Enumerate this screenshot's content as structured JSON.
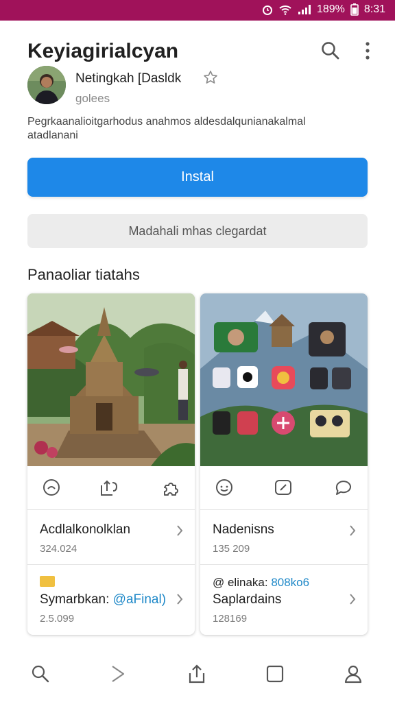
{
  "status_bar": {
    "battery": "189%",
    "time": "8:31"
  },
  "header": {
    "title": "Keyiagirialcyan"
  },
  "profile": {
    "name": "Netingkah [Dasldk",
    "subtitle": "golees"
  },
  "description": "Pegrkaanalioitgarhodus anahmos aldesdalqunianakalmal atadlanani",
  "buttons": {
    "install_label": "Instal",
    "secondary_label": "Madahali mhas clegardat"
  },
  "section_title": "Panaoliar tiatahs",
  "cards": [
    {
      "row1_title": "Acdlalkonolklan",
      "row1_count": "324.024",
      "row2_tag": "",
      "row2_title_prefix": "Symarbkan: ",
      "row2_title_accent": "@aFinal)",
      "row2_count": "2.5.099",
      "actions": [
        "smile-icon",
        "share-icon",
        "puzzle-icon"
      ]
    },
    {
      "row1_title": "Nadenisns",
      "row1_count": "135 209",
      "row2_tag_prefix": "@ elinaka: ",
      "row2_tag_accent": "808ko6",
      "row2_title": "Saplardains",
      "row2_count": "128169",
      "actions": [
        "emoji-icon",
        "edit-icon",
        "chat-icon"
      ]
    }
  ],
  "bottom_nav": [
    "search-icon",
    "forward-icon",
    "share-icon",
    "square-icon",
    "profile-icon"
  ],
  "colors": {
    "status_bar": "#a0125a",
    "primary": "#1e88e8",
    "accent_text": "#1e88c8"
  }
}
